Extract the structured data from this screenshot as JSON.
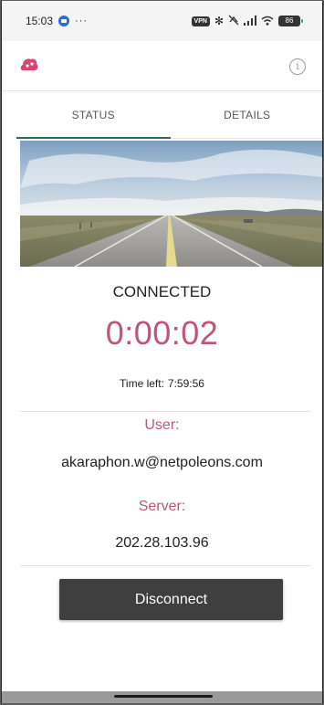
{
  "status_bar": {
    "time": "15:03",
    "more": "···",
    "vpn": "VPN",
    "battery": "86"
  },
  "tabs": [
    {
      "label": "STATUS",
      "active": true
    },
    {
      "label": "DETAILS",
      "active": false
    }
  ],
  "connection": {
    "state": "CONNECTED",
    "elapsed": "0:00:02",
    "time_left_label": "Time left:",
    "time_left_value": "7:59:56"
  },
  "user": {
    "label": "User:",
    "value": "akaraphon.w@netpoleons.com"
  },
  "server": {
    "label": "Server:",
    "value": "202.28.103.96"
  },
  "actions": {
    "disconnect_label": "Disconnect"
  },
  "icons": {
    "logo": "app-logo",
    "info": "info-icon"
  },
  "colors": {
    "accent": "#c0557b",
    "tab_indicator": "#2e6b5c",
    "button": "#3f3f3f",
    "logo": "#d8456e"
  }
}
